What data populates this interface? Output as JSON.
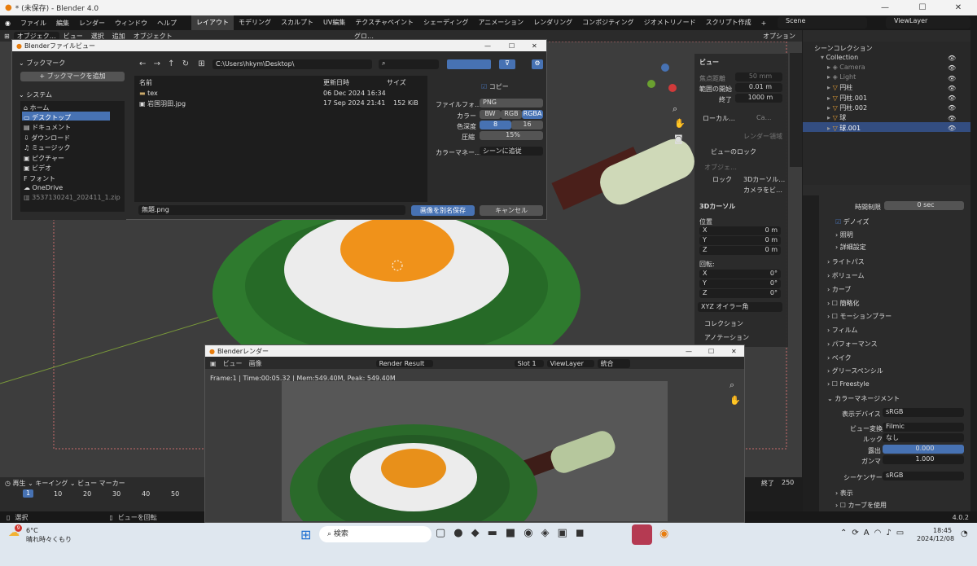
{
  "window": {
    "title": "* (未保存) - Blender 4.0"
  },
  "menu": [
    "ファイル",
    "編集",
    "レンダー",
    "ウィンドウ",
    "ヘルプ"
  ],
  "workspaces": [
    "レイアウト",
    "モデリング",
    "スカルプト",
    "UV編集",
    "テクスチャペイント",
    "シェーディング",
    "アニメーション",
    "レンダリング",
    "コンポジティング",
    "ジオメトリノード",
    "スクリプト作成"
  ],
  "scene": {
    "name": "Scene",
    "view_layer": "ViewLayer"
  },
  "header": {
    "mode": "オブジェク…",
    "view": "ビュー",
    "select": "選択",
    "add": "追加",
    "object": "オブジェクト",
    "transform": "グロ…",
    "options": "オプション"
  },
  "file_browser": {
    "title": "Blenderファイルビュー",
    "bookmarks_label": "ブックマーク",
    "add_bookmark": "ブックマークを追加",
    "system_label": "システム",
    "system_items": [
      "ホーム",
      "デスクトップ",
      "ドキュメント",
      "ダウンロード",
      "ミュージック",
      "ピクチャー",
      "ビデオ",
      "フォント",
      "OneDrive",
      "3537130241_202411_1.zip"
    ],
    "path": "C:\\Users\\hkym\\Desktop\\",
    "columns": {
      "name": "名前",
      "modified": "更新日時",
      "size": "サイズ"
    },
    "files": [
      {
        "name": "tex",
        "modified": "06 Dec 2024 16:34",
        "size": ""
      },
      {
        "name": "岩国羽田.jpg",
        "modified": "17 Sep 2024 21:41",
        "size": "152 KiB"
      }
    ],
    "copy_label": "コピー",
    "file_format_label": "ファイルフォ…",
    "file_format": "PNG",
    "color_label": "カラー",
    "color_options": [
      "BW",
      "RGB",
      "RGBA"
    ],
    "depth_label": "色深度",
    "depth_options": [
      "8",
      "16"
    ],
    "compression_label": "圧縮",
    "compression": "15%",
    "color_manage_label": "カラーマネー…",
    "color_manage": "シーンに追従",
    "filename": "無題.png",
    "save_button": "画像を別名保存",
    "cancel_button": "キャンセル"
  },
  "npanel": {
    "view_label": "ビュー",
    "focal_label": "焦点距離",
    "focal": "50 mm",
    "clip_start_label": "範囲の開始",
    "clip_start": "0.01 m",
    "clip_end_label": "終了",
    "clip_end": "1000 m",
    "local_label": "ローカル…",
    "local_val": "Ca…",
    "render_region": "レンダー領域",
    "view_lock": "ビューのロック",
    "object_label": "オブジェ…",
    "lock_label": "ロック",
    "cursor3d_check": "3Dカーソル…",
    "camera_check": "カメラをビ…",
    "cursor_label": "3Dカーソル",
    "location_label": "位置",
    "x": "X",
    "y": "Y",
    "z": "Z",
    "loc_vals": [
      "0 m",
      "0 m",
      "0 m"
    ],
    "rotation_label": "回転:",
    "rot_vals": [
      "0°",
      "0°",
      "0°"
    ],
    "euler": "XYZ オイラー角",
    "collection_label": "コレクション",
    "annotation_label": "アノテーション"
  },
  "outliner": {
    "title": "シーンコレクション",
    "items": [
      {
        "name": "Collection"
      },
      {
        "name": "Camera"
      },
      {
        "name": "Light"
      },
      {
        "name": "円柱"
      },
      {
        "name": "円柱.001"
      },
      {
        "name": "円柱.002"
      },
      {
        "name": "球"
      },
      {
        "name": "球.001"
      }
    ]
  },
  "properties": {
    "time_limit_label": "時間制限",
    "time_limit": "0 sec",
    "denoise": "デノイズ",
    "lighting": "照明",
    "advanced": "詳細設定",
    "panels": [
      "ライトパス",
      "ボリューム",
      "カーブ",
      "簡略化",
      "モーションブラー",
      "フィルム",
      "パフォーマンス",
      "ベイク",
      "グリースペンシル",
      "Freestyle",
      "カラーマネージメント"
    ],
    "display_device_label": "表示デバイス",
    "display_device": "sRGB",
    "view_transform_label": "ビュー変換",
    "view_transform": "Filmic",
    "look_label": "ルック",
    "look": "なし",
    "exposure_label": "露出",
    "exposure": "0.000",
    "gamma_label": "ガンマ",
    "gamma": "1.000",
    "sequencer_label": "シーケンサー",
    "sequencer": "sRGB",
    "display_label": "表示",
    "use_curve": "カーブを使用"
  },
  "render_window": {
    "title": "Blenderレンダー",
    "view": "ビュー",
    "image": "画像",
    "result": "Render Result",
    "slot": "Slot 1",
    "viewlayer": "ViewLayer",
    "composite": "統合",
    "info": "Frame:1 | Time:00:05.32 | Mem:549.40M, Peak: 549.40M"
  },
  "timeline": {
    "playback": "再生",
    "keying": "キーイング",
    "view": "ビュー",
    "marker": "マーカー",
    "frame": "1",
    "ticks": [
      "10",
      "20",
      "30",
      "40",
      "50"
    ],
    "start_label": "終了",
    "end": "250"
  },
  "status": {
    "select": "選択",
    "rotate": "ビューを回転",
    "version": "4.0.2"
  },
  "taskbar": {
    "weather_temp": "6°C",
    "weather_text": "晴れ時々くもり",
    "weather_badge": "9",
    "search": "検索",
    "time": "18:45",
    "date": "2024/12/08",
    "ime": "A"
  },
  "colors": {
    "accent": "#4772b3",
    "pan": "#2e7a2e",
    "yolk": "#f29a1e",
    "white": "#f2f2f2",
    "handle": "#b6c79d"
  }
}
